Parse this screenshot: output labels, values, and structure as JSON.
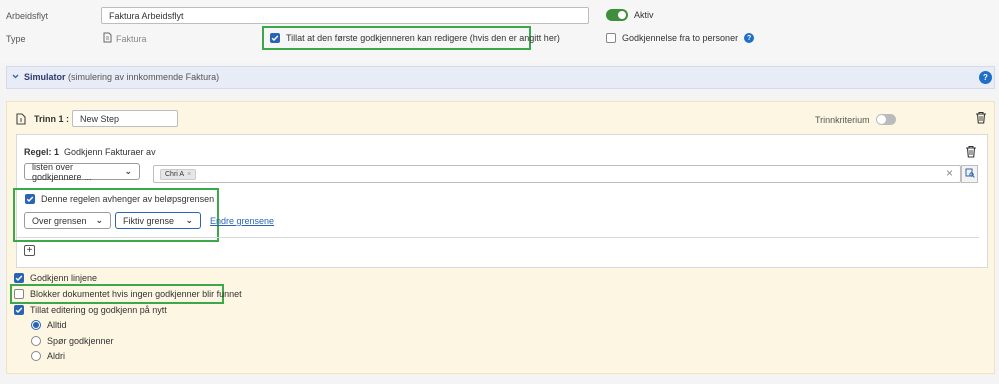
{
  "header": {
    "workflow_label": "Arbeidsflyt",
    "workflow_value": "Faktura Arbeidsflyt",
    "active_label": "Aktiv",
    "type_label": "Type",
    "type_value": "Faktura",
    "allow_first_approver_edit": "Tillat at den første godkjenneren kan redigere (hvis den er angitt her)",
    "two_person_approval": "Godkjennelse fra to personer"
  },
  "simulator": {
    "title": "Simulator",
    "subtitle": "(simulering av innkommende Faktura)"
  },
  "step": {
    "label": "Trinn 1 :",
    "name_value": "New Step",
    "criteria_label": "Trinnkriterium"
  },
  "rule": {
    "title": "Regel: 1",
    "description": "Godkjenn Fakturaer av",
    "approver_select": "listen over godkjennere ...",
    "chip_label": "Chri A",
    "chip_remove": "×",
    "clear_symbol": "×",
    "amount_dependent_label": "Denne regelen avhenger av beløpsgrensen",
    "condition_select": "Over grensen",
    "limit_select": "Fiktiv grense",
    "change_limits_link": "Endre grensene",
    "add_symbol": "+"
  },
  "options": {
    "approve_lines": "Godkjenn linjene",
    "block_document": "Blokker dokumentet hvis ingen godkjenner blir funnet",
    "allow_edit_reapprove": "Tillat editering og godkjenn på nytt",
    "radio_always": "Alltid",
    "radio_ask_approver": "Spør godkjenner",
    "radio_never": "Aldri"
  },
  "icons": {
    "help": "?",
    "collapse_chevron": "⌄"
  },
  "colors": {
    "accent_blue": "#2a64b5",
    "highlight_green": "#3aa84b",
    "active_toggle": "#3d8f3d",
    "step_background": "#fdf6e3",
    "simulator_background": "#e8ecf6"
  }
}
